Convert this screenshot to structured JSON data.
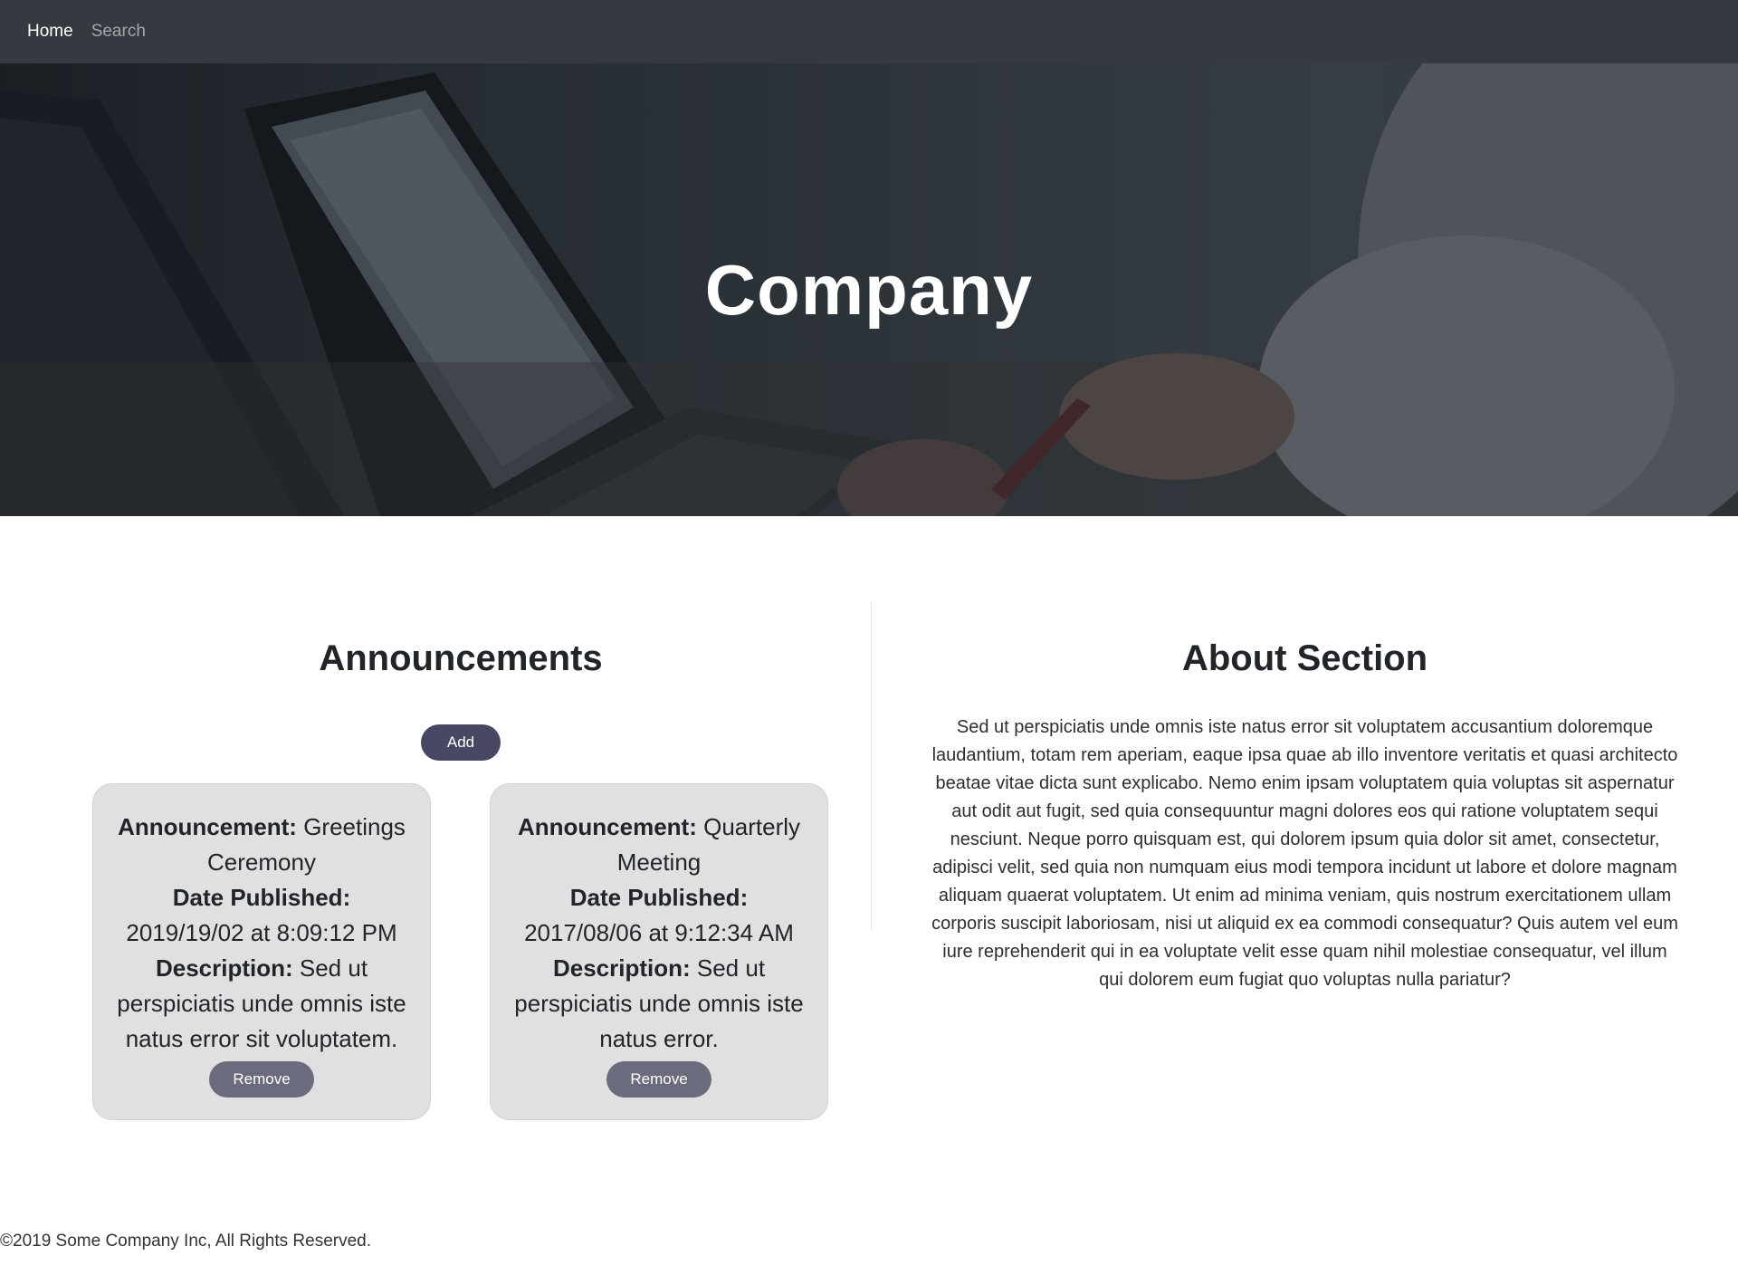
{
  "navbar": {
    "home_label": "Home",
    "search_label": "Search"
  },
  "hero": {
    "title": "Company"
  },
  "announcements": {
    "heading": "Announcements",
    "add_label": "Add",
    "items": [
      {
        "announcement_label": "Announcement:",
        "announcement_value": "Greetings Ceremony",
        "date_label": "Date Published:",
        "date_value": "2019/19/02 at 8:09:12 PM",
        "description_label": "Description:",
        "description_value": "Sed ut perspiciatis unde omnis iste natus error sit voluptatem.",
        "remove_label": "Remove"
      },
      {
        "announcement_label": "Announcement:",
        "announcement_value": "Quarterly Meeting",
        "date_label": "Date Published:",
        "date_value": "2017/08/06 at 9:12:34 AM",
        "description_label": "Description:",
        "description_value": "Sed ut perspiciatis unde omnis iste natus error.",
        "remove_label": "Remove"
      }
    ]
  },
  "about": {
    "heading": "About Section",
    "text": "Sed ut perspiciatis unde omnis iste natus error sit voluptatem accusantium doloremque laudantium, totam rem aperiam, eaque ipsa quae ab illo inventore veritatis et quasi architecto beatae vitae dicta sunt explicabo. Nemo enim ipsam voluptatem quia voluptas sit aspernatur aut odit aut fugit, sed quia consequuntur magni dolores eos qui ratione voluptatem sequi nesciunt. Neque porro quisquam est, qui dolorem ipsum quia dolor sit amet, consectetur, adipisci velit, sed quia non numquam eius modi tempora incidunt ut labore et dolore magnam aliquam quaerat voluptatem. Ut enim ad minima veniam, quis nostrum exercitationem ullam corporis suscipit laboriosam, nisi ut aliquid ex ea commodi consequatur? Quis autem vel eum iure reprehenderit qui in ea voluptate velit esse quam nihil molestiae consequatur, vel illum qui dolorem eum fugiat quo voluptas nulla pariatur?"
  },
  "footer": {
    "text": "©2019 Some Company Inc, All Rights Reserved."
  },
  "colors": {
    "navbar_bg": "#343a40",
    "add_button": "#474863",
    "remove_button": "#6b6b7e",
    "card_bg": "#e0e0e0"
  }
}
